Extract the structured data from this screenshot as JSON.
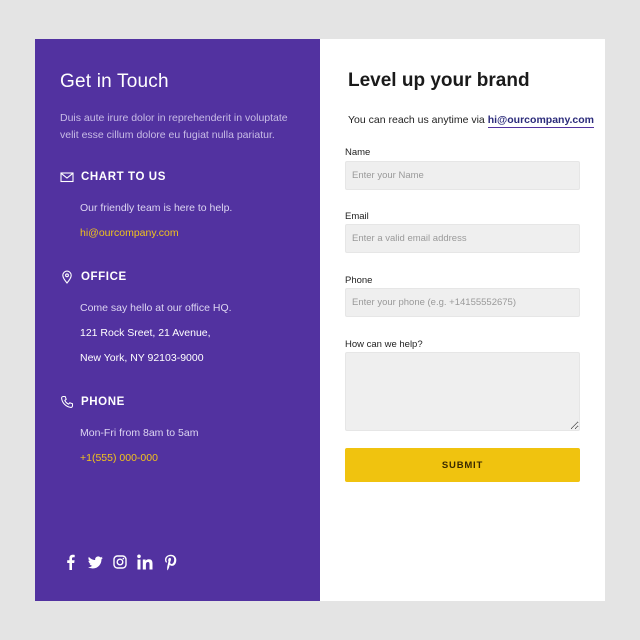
{
  "contact": {
    "title": "Get in Touch",
    "description": "Duis aute irure dolor in reprehenderit in voluptate velit esse cillum dolore eu fugiat nulla pariatur.",
    "chat": {
      "heading": "CHART TO US",
      "text": "Our friendly team is here to help.",
      "email": "hi@ourcompany.com",
      "icon": "envelope-icon"
    },
    "office": {
      "heading": "OFFICE",
      "text": "Come say hello at our office HQ.",
      "address_line1": "121 Rock Sreet, 21 Avenue,",
      "address_line2": "New York, NY 92103-9000",
      "icon": "map-pin-icon"
    },
    "phone": {
      "heading": "PHONE",
      "hours": "Mon-Fri from 8am to 5am",
      "number": "+1(555) 000-000",
      "icon": "phone-icon"
    },
    "socials": [
      "facebook-icon",
      "twitter-icon",
      "instagram-icon",
      "linkedin-icon",
      "pinterest-icon"
    ]
  },
  "form": {
    "title": "Level up your brand",
    "reach_prefix": "You can reach us anytime via ",
    "reach_email": "hi@ourcompany.com",
    "name_label": "Name",
    "name_placeholder": "Enter your Name",
    "email_label": "Email",
    "email_placeholder": "Enter a valid email address",
    "phone_label": "Phone",
    "phone_placeholder": "Enter your phone (e.g. +14155552675)",
    "message_label": "How can we help?",
    "message_placeholder": "",
    "submit_label": "SUBMIT"
  },
  "colors": {
    "panel": "#5232a0",
    "accent": "#f0c30f",
    "background": "#e4e4e4"
  }
}
